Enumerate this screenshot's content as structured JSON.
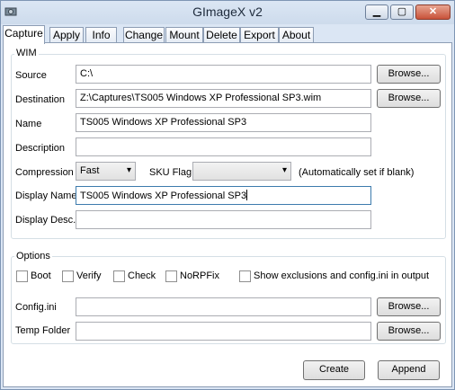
{
  "window": {
    "title": "GImageX v2"
  },
  "tabs": [
    "Capture",
    "Apply",
    "Info",
    "Change",
    "Mount",
    "Delete",
    "Export",
    "About"
  ],
  "wim": {
    "legend": "WIM",
    "source_label": "Source",
    "source_value": "C:\\",
    "destination_label": "Destination",
    "destination_value": "Z:\\Captures\\TS005 Windows XP Professional SP3.wim",
    "name_label": "Name",
    "name_value": "TS005 Windows XP Professional SP3",
    "description_label": "Description",
    "description_value": "",
    "compression_label": "Compression",
    "compression_value": "Fast",
    "sku_label": "SKU Flag",
    "sku_value": "",
    "sku_note": "(Automatically set if blank)",
    "display_name_label": "Display Name",
    "display_name_value": "TS005 Windows XP Professional SP3",
    "display_desc_label": "Display Desc.",
    "display_desc_value": "",
    "browse_label": "Browse..."
  },
  "options": {
    "legend": "Options",
    "checkboxes": [
      "Boot",
      "Verify",
      "Check",
      "NoRPFix",
      "Show exclusions and config.ini in output"
    ],
    "config_label": "Config.ini",
    "config_value": "",
    "temp_label": "Temp Folder",
    "temp_value": "",
    "browse_label": "Browse..."
  },
  "actions": {
    "create": "Create",
    "append": "Append"
  }
}
